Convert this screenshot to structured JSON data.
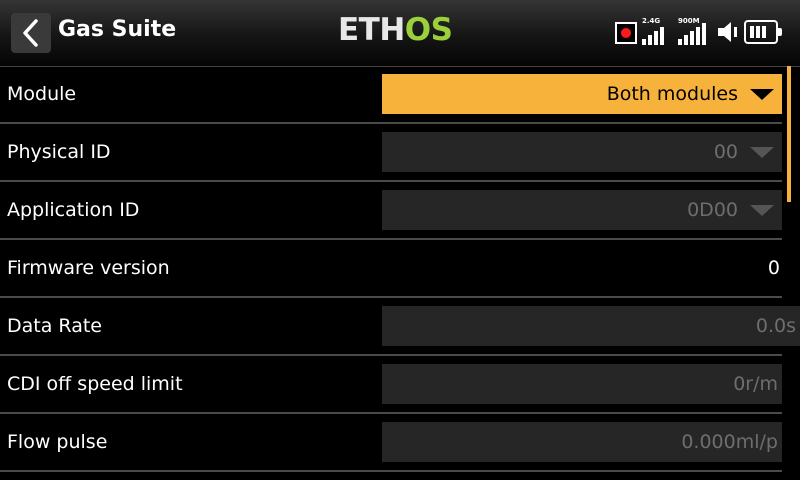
{
  "header": {
    "title": "Gas Suite",
    "logo_main": "ETH",
    "logo_accent": "OS",
    "signal_1_label": "2.4G",
    "signal_2_label": "900M"
  },
  "rows": [
    {
      "label": "Module",
      "value": "Both modules",
      "kind": "dropdown",
      "state": "active"
    },
    {
      "label": "Physical ID",
      "value": "00",
      "kind": "dropdown",
      "state": "disabled"
    },
    {
      "label": "Application ID",
      "value": "0D00",
      "kind": "dropdown",
      "state": "disabled"
    },
    {
      "label": "Firmware version",
      "value": "0",
      "kind": "text"
    },
    {
      "label": "Data Rate",
      "value": "0.0s",
      "kind": "numeric",
      "state": "disabled"
    },
    {
      "label": "CDI off speed limit",
      "value": "0r/m",
      "kind": "numeric",
      "state": "disabled"
    },
    {
      "label": "Flow pulse",
      "value": "0.000ml/p",
      "kind": "numeric",
      "state": "disabled"
    }
  ],
  "colors": {
    "accent": "#f7b23b",
    "logo_green": "#9bd03a",
    "record_red": "#ff1a1a"
  }
}
